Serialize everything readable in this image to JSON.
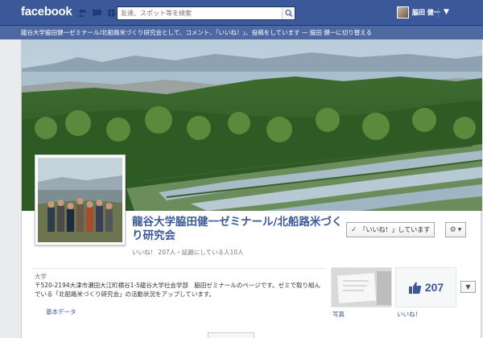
{
  "header": {
    "logo": "facebook",
    "search_placeholder": "友達、スポット等を検索",
    "user_name": "脇田 健一",
    "home_label": "▼"
  },
  "notice": {
    "text": "龍谷大学脇田健一ゼミナール/北船路米づくり研究会として、コメント、「いいね！」、投稿をしています — 脇田 健一に切り替える"
  },
  "page": {
    "title": "龍谷大学脇田健一ゼミナール/北船路米づくり研究会",
    "stats": "いいね！ 207人・話題にしている人10人",
    "like_button_label": "「いいね！」しています",
    "category": "大学",
    "description": "〒520-2194大津市瀬田大江町横谷1-5龍谷大学社会学部　脇田ゼミナールのページです。ゼミで取り組んでいる「北船路米づくり研究会」の活動状況をアップしています。",
    "basic_data_label": "基本データ",
    "photos_label": "写真",
    "likes_label": "いいね！",
    "likes_count": "207"
  },
  "colors": {
    "brand": "#3b5998",
    "notice": "#4e69a2"
  }
}
